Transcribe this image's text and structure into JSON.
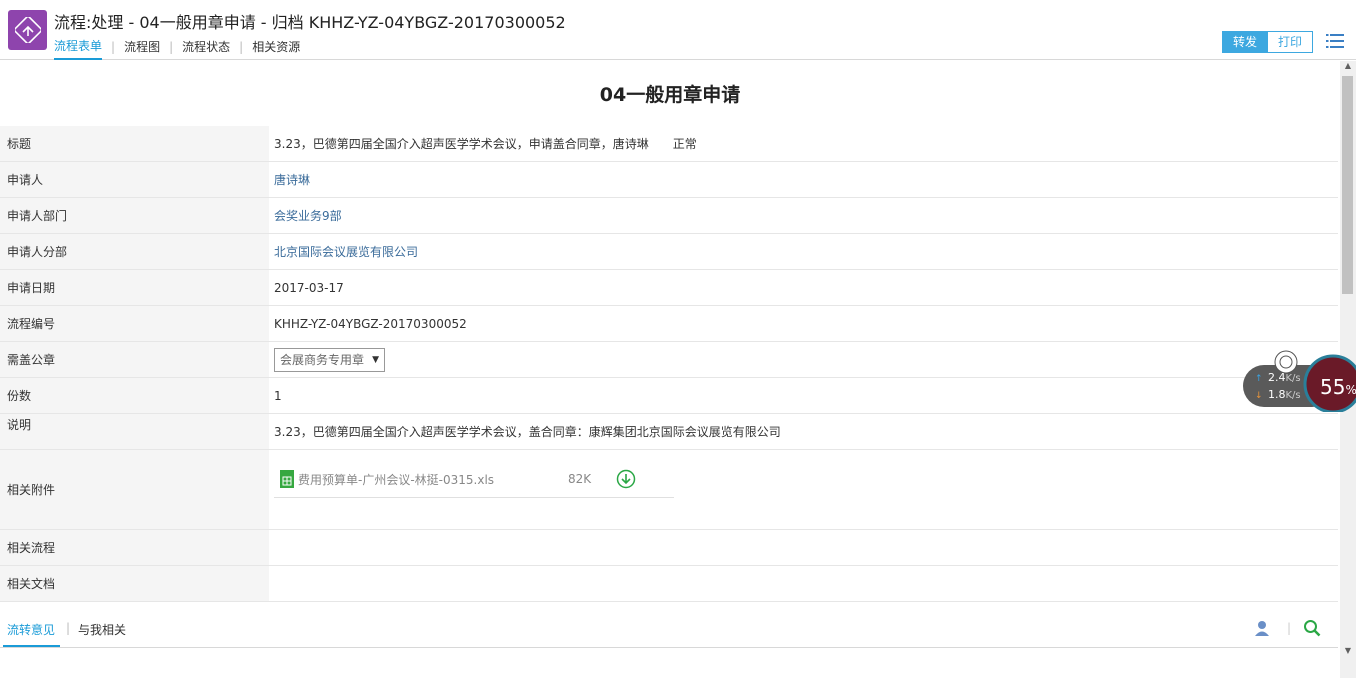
{
  "header": {
    "title": "流程:处理 - 04一般用章申请 - 归档 KHHZ-YZ-04YBGZ-20170300052",
    "tabs": [
      "流程表单",
      "流程图",
      "流程状态",
      "相关资源"
    ],
    "forward_label": "转发",
    "print_label": "打印"
  },
  "form": {
    "title": "04一般用章申请",
    "rows": {
      "subject": {
        "label": "标题",
        "value": "3.23，巴德第四届全国介入超声医学学术会议，申请盖合同章，唐诗琳",
        "status": "正常"
      },
      "applicant": {
        "label": "申请人",
        "value": "唐诗琳"
      },
      "department": {
        "label": "申请人部门",
        "value": "会奖业务9部"
      },
      "branch": {
        "label": "申请人分部",
        "value": "北京国际会议展览有限公司"
      },
      "date": {
        "label": "申请日期",
        "value": "2017-03-17"
      },
      "flow_no": {
        "label": "流程编号",
        "value": "KHHZ-YZ-04YBGZ-20170300052"
      },
      "seal": {
        "label": "需盖公章",
        "value": "会展商务专用章"
      },
      "copies": {
        "label": "份数",
        "value": "1"
      },
      "description": {
        "label": "说明",
        "value": "3.23，巴德第四届全国介入超声医学学术会议，盖合同章：康辉集团北京国际会议展览有限公司"
      },
      "attachments": {
        "label": "相关附件",
        "file_name": "费用预算单-广州会议-林挺-0315.xls",
        "file_size": "82K"
      },
      "related_flow": {
        "label": "相关流程"
      },
      "related_docs": {
        "label": "相关文档"
      }
    }
  },
  "bottom_tabs": [
    "流转意见",
    "与我相关"
  ],
  "net_widget": {
    "upload": "2.4",
    "upload_unit": "K/s",
    "download": "1.8",
    "download_unit": "K/s",
    "percent": "55",
    "percent_sign": "%"
  },
  "colors": {
    "accent": "#1a9bd7",
    "app_icon": "#8e44ad",
    "excel": "#36a840"
  }
}
